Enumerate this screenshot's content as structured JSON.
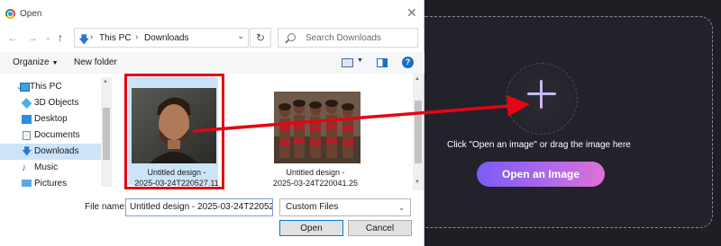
{
  "dialog": {
    "title": "Open",
    "breadcrumb": [
      "This PC",
      "Downloads"
    ],
    "search_placeholder": "Search Downloads",
    "toolbar": {
      "organize": "Organize",
      "new_folder": "New folder",
      "help": "?"
    },
    "nav_items": [
      {
        "label": "This PC",
        "icon": "computer-icon"
      },
      {
        "label": "3D Objects",
        "icon": "cube-icon"
      },
      {
        "label": "Desktop",
        "icon": "desktop-icon"
      },
      {
        "label": "Documents",
        "icon": "document-icon"
      },
      {
        "label": "Downloads",
        "icon": "download-icon",
        "selected": true
      },
      {
        "label": "Music",
        "icon": "music-icon"
      },
      {
        "label": "Pictures",
        "icon": "pictures-icon"
      }
    ],
    "files": [
      {
        "name_line1": "Untitled design -",
        "name_line2": "2025-03-24T220527.11",
        "selected": true
      },
      {
        "name_line1": "Untitled design -",
        "name_line2": "2025-03-24T220041.25",
        "selected": false
      }
    ],
    "file_name_label": "File name:",
    "file_name_value": "Untitled design - 2025-03-24T22052",
    "file_type": "Custom Files",
    "open_label": "Open",
    "cancel_label": "Cancel"
  },
  "app": {
    "drop_hint": "Click \"Open an image\" or drag the image here",
    "open_button": "Open an Image"
  },
  "colors": {
    "highlight_box": "#e30613",
    "arrow": "#e30613",
    "plus": "#c9b8f2",
    "button_gradient_start": "#7a5cf5",
    "button_gradient_end": "#e070d8"
  }
}
